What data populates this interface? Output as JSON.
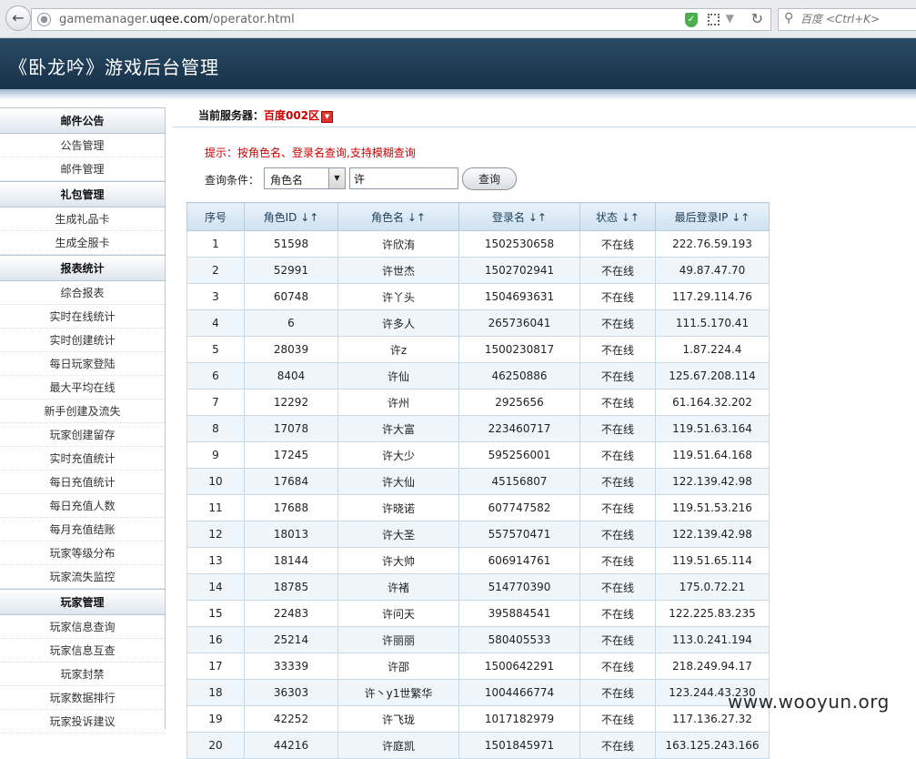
{
  "browser": {
    "url_prefix": "gamemanager.",
    "url_domain": "uqee.com",
    "url_path": "/operator.html",
    "search_placeholder": "百度 <Ctrl+K>"
  },
  "header": {
    "title": "《卧龙吟》游戏后台管理"
  },
  "sidebar": {
    "sections": [
      {
        "title": "邮件公告",
        "items": [
          "公告管理",
          "邮件管理"
        ]
      },
      {
        "title": "礼包管理",
        "items": [
          "生成礼品卡",
          "生成全服卡"
        ]
      },
      {
        "title": "报表统计",
        "items": [
          "综合报表",
          "实时在线统计",
          "实时创建统计",
          "每日玩家登陆",
          "最大平均在线",
          "新手创建及流失",
          "玩家创建留存",
          "实时充值统计",
          "每日充值统计",
          "每日充值人数",
          "每月充值结账",
          "玩家等级分布",
          "玩家流失监控"
        ]
      },
      {
        "title": "玩家管理",
        "items": [
          "玩家信息查询",
          "玩家信息互查",
          "玩家封禁",
          "玩家数据排行",
          "玩家投诉建议"
        ]
      }
    ]
  },
  "server": {
    "label": "当前服务器：",
    "name": "百度002区"
  },
  "hint": "提示：按角色名、登录名查询,支持模糊查询",
  "query": {
    "label": "查询条件：",
    "select_value": "角色名",
    "input_value": "许",
    "button": "查询"
  },
  "table": {
    "headers": [
      "序号",
      "角色ID ↓↑",
      "角色名 ↓↑",
      "登录名 ↓↑",
      "状态 ↓↑",
      "最后登录IP ↓↑"
    ],
    "rows": [
      [
        "1",
        "51598",
        "许欣洧",
        "1502530658",
        "不在线",
        "222.76.59.193"
      ],
      [
        "2",
        "52991",
        "许世杰",
        "1502702941",
        "不在线",
        "49.87.47.70"
      ],
      [
        "3",
        "60748",
        "许丫头",
        "1504693631",
        "不在线",
        "117.29.114.76"
      ],
      [
        "4",
        "6",
        "许多人",
        "265736041",
        "不在线",
        "111.5.170.41"
      ],
      [
        "5",
        "28039",
        "许z",
        "1500230817",
        "不在线",
        "1.87.224.4"
      ],
      [
        "6",
        "8404",
        "许仙",
        "46250886",
        "不在线",
        "125.67.208.114"
      ],
      [
        "7",
        "12292",
        "许州",
        "2925656",
        "不在线",
        "61.164.32.202"
      ],
      [
        "8",
        "17078",
        "许大富",
        "223460717",
        "不在线",
        "119.51.63.164"
      ],
      [
        "9",
        "17245",
        "许大少",
        "595256001",
        "不在线",
        "119.51.64.168"
      ],
      [
        "10",
        "17684",
        "许大仙",
        "45156807",
        "不在线",
        "122.139.42.98"
      ],
      [
        "11",
        "17688",
        "许晓诺",
        "607747582",
        "不在线",
        "119.51.53.216"
      ],
      [
        "12",
        "18013",
        "许大圣",
        "557570471",
        "不在线",
        "122.139.42.98"
      ],
      [
        "13",
        "18144",
        "许大帅",
        "606914761",
        "不在线",
        "119.51.65.114"
      ],
      [
        "14",
        "18785",
        "许褚",
        "514770390",
        "不在线",
        "175.0.72.21"
      ],
      [
        "15",
        "22483",
        "许问天",
        "395884541",
        "不在线",
        "122.225.83.235"
      ],
      [
        "16",
        "25214",
        "许丽丽",
        "580405533",
        "不在线",
        "113.0.241.194"
      ],
      [
        "17",
        "33339",
        "许邵",
        "1500642291",
        "不在线",
        "218.249.94.17"
      ],
      [
        "18",
        "36303",
        "许丶y1世繁华",
        "1004466774",
        "不在线",
        "123.244.43.230"
      ],
      [
        "19",
        "42252",
        "许飞珑",
        "1017182979",
        "不在线",
        "117.136.27.32"
      ],
      [
        "20",
        "44216",
        "许庭凯",
        "1501845971",
        "不在线",
        "163.125.243.166"
      ]
    ]
  },
  "watermark": "www.wooyun.org",
  "colors": {
    "header_bg": "#1f3d55",
    "status_offline": "#dd0000",
    "hint": "#cc0000"
  }
}
